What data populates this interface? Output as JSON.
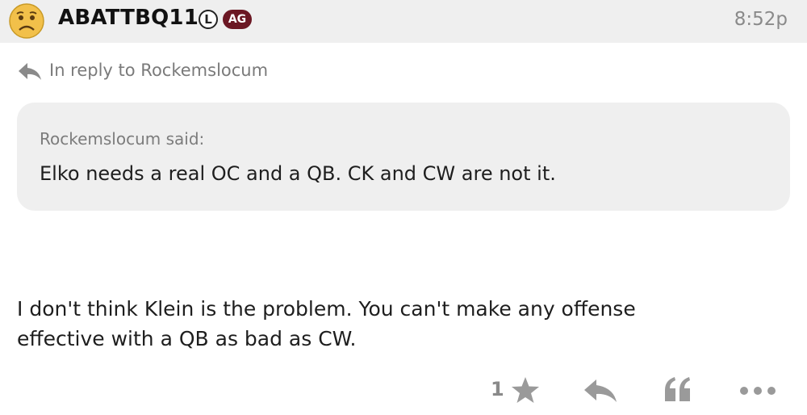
{
  "post": {
    "username": "ABATTBQ11",
    "badges": {
      "l": "L",
      "ag": "AG"
    },
    "timestamp": "8:52p",
    "reply_to": "In reply to Rockemslocum",
    "quote": {
      "author": "Rockemslocum said:",
      "text": "Elko needs a real OC and a QB. CK and CW are not it."
    },
    "body": {
      "line1": "I don't think Klein is the problem. You can't make any offense",
      "line2": "effective with a QB as bad as CW."
    },
    "actions": {
      "like_count": "1"
    }
  },
  "icons": {
    "avatar": "worried-face-avatar",
    "reply_indicator": "reply-arrow-icon",
    "like": "star-icon",
    "reply": "reply-arrow-icon",
    "quote": "quote-marks-icon",
    "more": "ellipsis-icon"
  },
  "colors": {
    "header_bg": "#efefef",
    "quote_bg": "#efefef",
    "badge_ag": "#6b1723",
    "muted_text": "#8a8a8a",
    "body_text": "#1e1e1e"
  }
}
